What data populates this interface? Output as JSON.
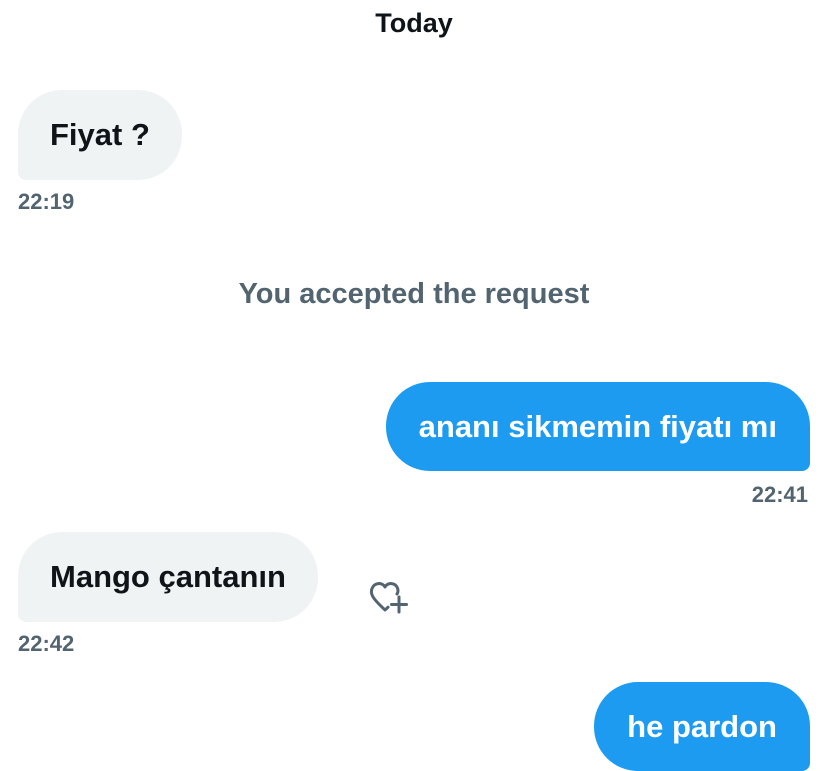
{
  "conversation": {
    "date_header": "Today",
    "system_note": "You accepted the request",
    "messages": [
      {
        "direction": "incoming",
        "text": "Fiyat ?",
        "time": "22:19"
      },
      {
        "direction": "outgoing",
        "text": "ananı sikmemin fiyatı mı",
        "time": "22:41"
      },
      {
        "direction": "incoming",
        "text": "Mango çantanın",
        "time": "22:42",
        "reaction_icon": "heart-plus-icon"
      },
      {
        "direction": "outgoing",
        "text": "he pardon"
      }
    ]
  },
  "colors": {
    "outgoing_bubble": "#1d9bf0",
    "incoming_bubble": "#eff3f4",
    "primary_text": "#0f1419",
    "secondary_text": "#536471"
  }
}
